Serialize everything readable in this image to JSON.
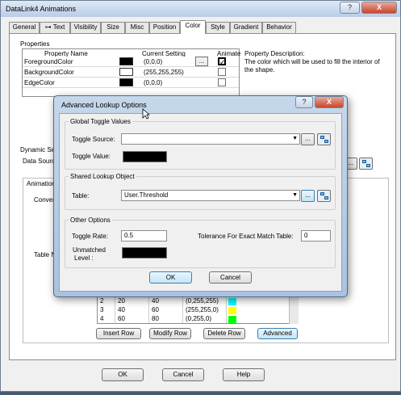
{
  "main_window": {
    "title": "DataLink4 Animations",
    "help_glyph": "?",
    "close_glyph": "X"
  },
  "tabs": [
    {
      "label": "General"
    },
    {
      "label": "Text"
    },
    {
      "label": "Visibility"
    },
    {
      "label": "Size"
    },
    {
      "label": "Misc"
    },
    {
      "label": "Position"
    },
    {
      "label": "Color"
    },
    {
      "label": "Style"
    },
    {
      "label": "Gradient"
    },
    {
      "label": "Behavior"
    }
  ],
  "active_tab": "Color",
  "properties": {
    "group_label": "Properties",
    "col_name": "Property Name",
    "col_setting": "Current Setting",
    "col_animate": "Animate",
    "rows": [
      {
        "name": "ForegroundColor",
        "swatch": "#000000",
        "value": "(0,0,0)",
        "animate": true,
        "has_button": true
      },
      {
        "name": "BackgroundColor",
        "swatch": "#ffffff",
        "value": "(255,255,255)",
        "animate": false,
        "has_button": false
      },
      {
        "name": "EdgeColor",
        "swatch": "#000000",
        "value": "(0,0,0)",
        "animate": false,
        "has_button": false
      }
    ],
    "ellipsis": "...",
    "desc_title": "Property Description:",
    "desc_text": "The color which will be used to fill the interior of the shape."
  },
  "dynamic_source": {
    "label": "Dynamic Se",
    "data_source_label": "Data Sourc",
    "ellipsis": "..."
  },
  "animation": {
    "group_label": "Animation",
    "conv_label": "Conver",
    "table_label": "Table N"
  },
  "back_table": {
    "rows": [
      {
        "n": "2",
        "a": "20",
        "b": "40",
        "c": "(0,255,255)",
        "color": "#00ffff"
      },
      {
        "n": "3",
        "a": "40",
        "b": "60",
        "c": "(255,255,0)",
        "color": "#ffff00"
      },
      {
        "n": "4",
        "a": "60",
        "b": "80",
        "c": "(0,255,0)",
        "color": "#00ff00"
      }
    ],
    "buttons": {
      "insert": "Insert Row",
      "modify": "Modify Row",
      "delete": "Delete Row",
      "advanced": "Advanced"
    }
  },
  "main_buttons": {
    "ok": "OK",
    "cancel": "Cancel",
    "help": "Help"
  },
  "dialog": {
    "title": "Advanced Lookup Options",
    "help_glyph": "?",
    "close_glyph": "X",
    "global_group": "Global Toggle Values",
    "toggle_source_label": "Toggle Source:",
    "toggle_source_value": "",
    "toggle_value_label": "Toggle Value:",
    "toggle_value_color": "#000000",
    "shared_group": "Shared Lookup Object",
    "table_label": "Table:",
    "table_value": "User.Threshold",
    "other_group": "Other Options",
    "toggle_rate_label": "Toggle Rate:",
    "toggle_rate_value": "0.5",
    "tolerance_label": "Tolerance For Exact Match Table:",
    "tolerance_value": "0",
    "unmatched_label_1": "Unmatched",
    "unmatched_label_2": "Level :",
    "unmatched_color": "#000000",
    "ellipsis": "...",
    "ok": "OK",
    "cancel": "Cancel"
  }
}
